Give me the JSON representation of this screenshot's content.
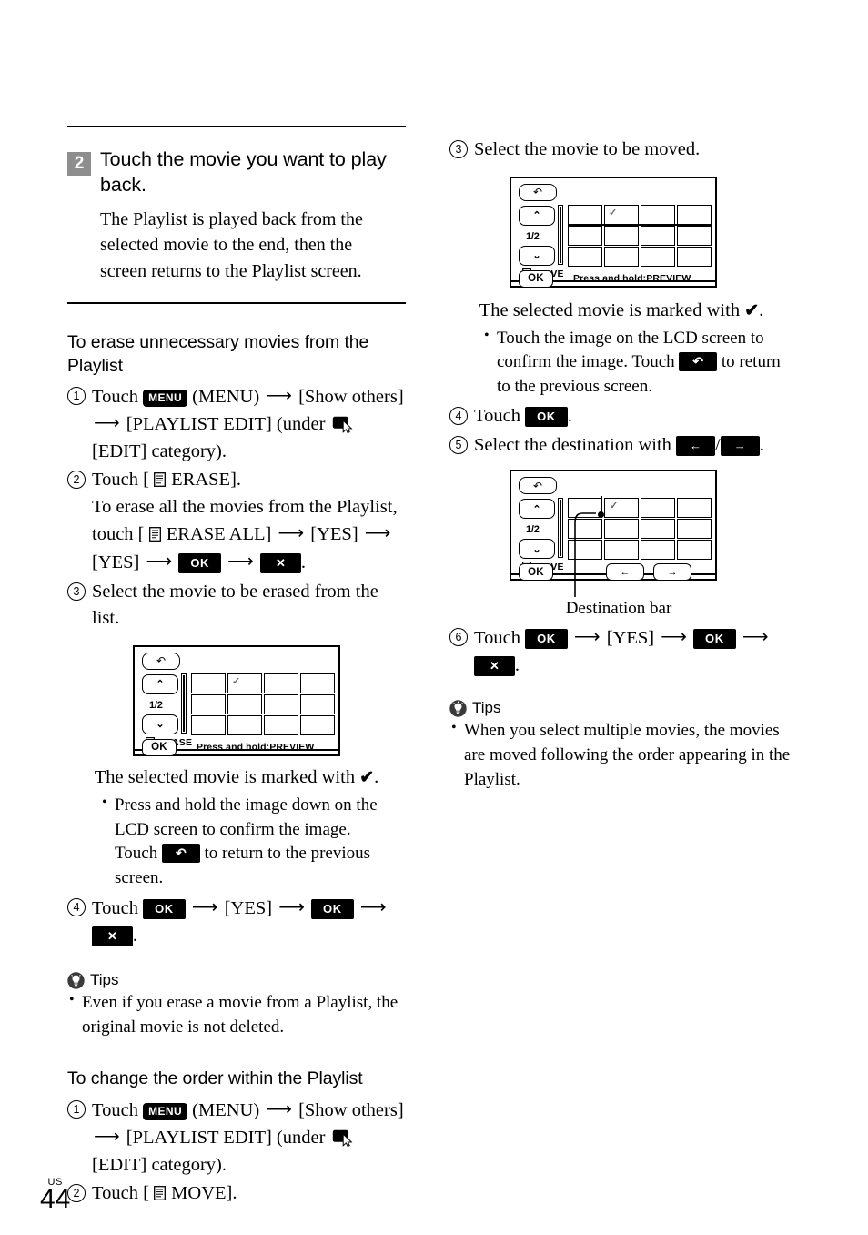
{
  "page": {
    "locale_mark": "US",
    "number": "44",
    "badge_color": "#8e8e8e"
  },
  "step2": {
    "badge": "2",
    "title": "Touch the movie you want to play back.",
    "body": "The Playlist is played back from the selected movie to the end, then the screen returns to the Playlist screen."
  },
  "erase_section": {
    "heading": "To erase unnecessary movies from the Playlist",
    "step1": {
      "marker": "1",
      "text_a": "Touch",
      "menu_button": "MENU",
      "menu_paren": "(MENU)",
      "arrow": "→",
      "show_others": "[Show others]",
      "playlist_edit": "[PLAYLIST EDIT] (under",
      "edit_category": "[EDIT] category)."
    },
    "step2": {
      "marker": "2",
      "text_a": "Touch [",
      "erase_label": "ERASE].",
      "body_a": "To erase all the movies from the Playlist, touch [",
      "erase_all_label": "ERASE ALL]",
      "yes": "[YES]",
      "ok_button": "OK",
      "x_button": "✕"
    },
    "step3": {
      "marker": "3",
      "text": "Select the movie to be erased from the list."
    },
    "caption": "The selected movie is marked with",
    "caption_check": "✔",
    "caption_end": ".",
    "bullet": {
      "part_a": "Press and hold the image down on the LCD screen to confirm the image. Touch",
      "back_button": "↶",
      "part_b": "to return to the previous screen."
    },
    "step4": {
      "marker": "4",
      "text_a": "Touch",
      "ok_button": "OK",
      "yes": "[YES]",
      "x_button": "✕"
    },
    "tips": {
      "label": "Tips",
      "items": [
        "Even if you erase a movie from a Playlist, the original movie is not deleted."
      ]
    }
  },
  "move_section": {
    "heading": "To change the order within the Playlist",
    "step1": {
      "marker": "1",
      "text_a": "Touch",
      "menu_button": "MENU",
      "menu_paren": "(MENU)",
      "show_others": "[Show others]",
      "playlist_edit": "[PLAYLIST EDIT] (under",
      "edit_category": "[EDIT] category)."
    },
    "step2": {
      "marker": "2",
      "text_a": "Touch [",
      "move_label": "MOVE]."
    },
    "step3": {
      "marker": "3",
      "text": "Select the movie to be moved."
    },
    "caption": "The selected movie is marked with",
    "caption_check": "✔",
    "caption_end": ".",
    "bullet": {
      "part_a": "Touch the image on the LCD screen to confirm the image. Touch",
      "back_button": "↶",
      "part_b": "to return to the previous screen."
    },
    "step4": {
      "marker": "4",
      "text_a": "Touch",
      "ok_button": "OK",
      "period": "."
    },
    "step5": {
      "marker": "5",
      "text_a": "Select the destination with",
      "left_button": "←",
      "slash": "/",
      "right_button": "→",
      "period": "."
    },
    "dest_caption": "Destination bar",
    "step6": {
      "marker": "6",
      "text_a": "Touch",
      "ok_button": "OK",
      "yes": "[YES]",
      "x_button": "✕"
    },
    "tips": {
      "label": "Tips",
      "items": [
        "When you select multiple movies, the movies are moved following the order appearing in the Playlist."
      ]
    }
  },
  "lcd_erase": {
    "back_icon": "↶",
    "up_icon": "⌃",
    "down_icon": "⌄",
    "page_indicator": "1/2",
    "mode_label": "ERASE",
    "ok_label": "OK",
    "hint": "Press and hold:PREVIEW",
    "checked_thumb_index": 1
  },
  "lcd_move_select": {
    "back_icon": "↶",
    "up_icon": "⌃",
    "down_icon": "⌄",
    "page_indicator": "1/2",
    "mode_label": "MOVE",
    "ok_label": "OK",
    "hint": "Press and hold:PREVIEW",
    "checked_thumb_index": 1
  },
  "lcd_move_dest": {
    "back_icon": "↶",
    "up_icon": "⌃",
    "down_icon": "⌄",
    "page_indicator": "1/2",
    "mode_label": "MOVE",
    "ok_label": "OK",
    "left_label": "←",
    "right_label": "→",
    "checked_thumb_index": 1
  }
}
